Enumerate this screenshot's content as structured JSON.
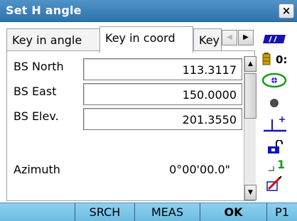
{
  "window": {
    "title": "Set H angle",
    "close_label": "×"
  },
  "tabs": [
    {
      "label": "Key in angle",
      "active": false
    },
    {
      "label": "Key in coord",
      "active": true
    },
    {
      "label": "Key",
      "active": false
    }
  ],
  "tab_scroll": {
    "left": "◀",
    "right": "▶"
  },
  "fields": [
    {
      "label": "BS North",
      "value": "113.3117"
    },
    {
      "label": "BS East",
      "value": "150.0000"
    },
    {
      "label": "BS Elev.",
      "value": "201.3550"
    }
  ],
  "azimuth": {
    "label": "Azimuth",
    "value": "0°00'00.0\""
  },
  "scrollbar": {
    "up": "▲",
    "down": "▼"
  },
  "status": {
    "battery_text": "0:",
    "signal_text": "1"
  },
  "softkeys": [
    "",
    "SRCH",
    "MEAS",
    "OK",
    "P1"
  ],
  "colors": {
    "title_bar": "#3f84bc",
    "softkey_bar": "#7fc8ea",
    "status_blue": "#1414b4",
    "status_green": "#1a9a1a"
  }
}
